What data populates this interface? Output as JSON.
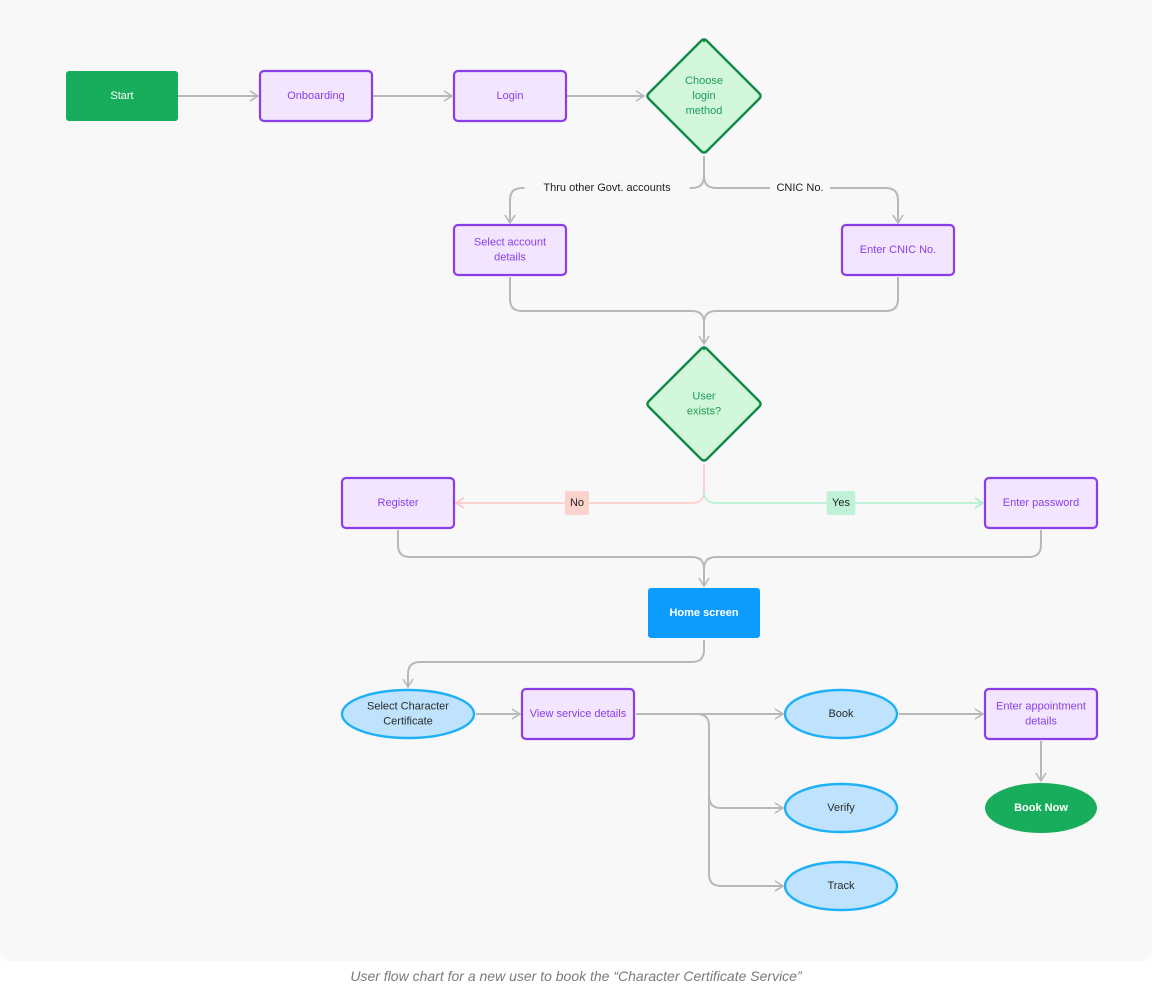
{
  "caption": "User flow chart for a new user to book the “Character Certificate Service”",
  "colors": {
    "canvas_bg": "#f8f8f8",
    "edge": "#b8b8b8",
    "edge_no": "#fcd2cd",
    "edge_yes": "#bff2d6",
    "terminal_fill": "#18ad5c",
    "terminal_text": "#ffffff",
    "process_fill": "#f3e5fe",
    "process_stroke": "#8a3ee8",
    "process_text": "#8a3ee8",
    "decision_fill": "#d2f6d9",
    "decision_stroke": "#118a45",
    "decision_text": "#1b9d55",
    "screen_fill": "#0e9bfe",
    "screen_text": "#ffffff",
    "option_fill": "#bfe3fc",
    "option_stroke": "#1fb0f5",
    "option_text": "#2a2a2a",
    "badge_no_fill": "#fcd2cd",
    "badge_yes_fill": "#bff2d6",
    "badge_text": "#222222"
  },
  "nodes": {
    "start": {
      "type": "terminal",
      "lines": [
        "Start"
      ]
    },
    "onboarding": {
      "type": "process",
      "lines": [
        "Onboarding"
      ]
    },
    "login": {
      "type": "process",
      "lines": [
        "Login"
      ]
    },
    "choose_login": {
      "type": "decision",
      "lines": [
        "Choose",
        "login",
        "method"
      ]
    },
    "select_account": {
      "type": "process",
      "lines": [
        "Select account",
        "details"
      ]
    },
    "enter_cnic": {
      "type": "process",
      "lines": [
        "Enter CNIC No."
      ]
    },
    "user_exists": {
      "type": "decision",
      "lines": [
        "User",
        "exists?"
      ]
    },
    "register": {
      "type": "process",
      "lines": [
        "Register"
      ]
    },
    "enter_password": {
      "type": "process",
      "lines": [
        "Enter password"
      ]
    },
    "home_screen": {
      "type": "screen",
      "lines": [
        "Home screen"
      ]
    },
    "select_cc": {
      "type": "option",
      "lines": [
        "Select Character",
        "Certificate"
      ]
    },
    "view_service": {
      "type": "process",
      "lines": [
        "View service details"
      ]
    },
    "book": {
      "type": "option",
      "lines": [
        "Book"
      ]
    },
    "verify": {
      "type": "option",
      "lines": [
        "Verify"
      ]
    },
    "track": {
      "type": "option",
      "lines": [
        "Track"
      ]
    },
    "enter_appointment": {
      "type": "process",
      "lines": [
        "Enter appointment",
        "details"
      ]
    },
    "book_now": {
      "type": "terminal-oval",
      "lines": [
        "Book Now"
      ]
    }
  },
  "edges": [
    {
      "from": "start",
      "to": "onboarding"
    },
    {
      "from": "onboarding",
      "to": "login"
    },
    {
      "from": "login",
      "to": "choose_login"
    },
    {
      "from": "choose_login",
      "to": "select_account",
      "label": "Thru other Govt. accounts"
    },
    {
      "from": "choose_login",
      "to": "enter_cnic",
      "label": "CNIC No."
    },
    {
      "from": "select_account",
      "to": "user_exists"
    },
    {
      "from": "enter_cnic",
      "to": "user_exists"
    },
    {
      "from": "user_exists",
      "to": "register",
      "label": "No",
      "kind": "no"
    },
    {
      "from": "user_exists",
      "to": "enter_password",
      "label": "Yes",
      "kind": "yes"
    },
    {
      "from": "register",
      "to": "home_screen"
    },
    {
      "from": "enter_password",
      "to": "home_screen"
    },
    {
      "from": "home_screen",
      "to": "select_cc"
    },
    {
      "from": "select_cc",
      "to": "view_service"
    },
    {
      "from": "view_service",
      "to": "book"
    },
    {
      "from": "view_service",
      "to": "verify"
    },
    {
      "from": "view_service",
      "to": "track"
    },
    {
      "from": "book",
      "to": "enter_appointment"
    },
    {
      "from": "enter_appointment",
      "to": "book_now"
    }
  ]
}
